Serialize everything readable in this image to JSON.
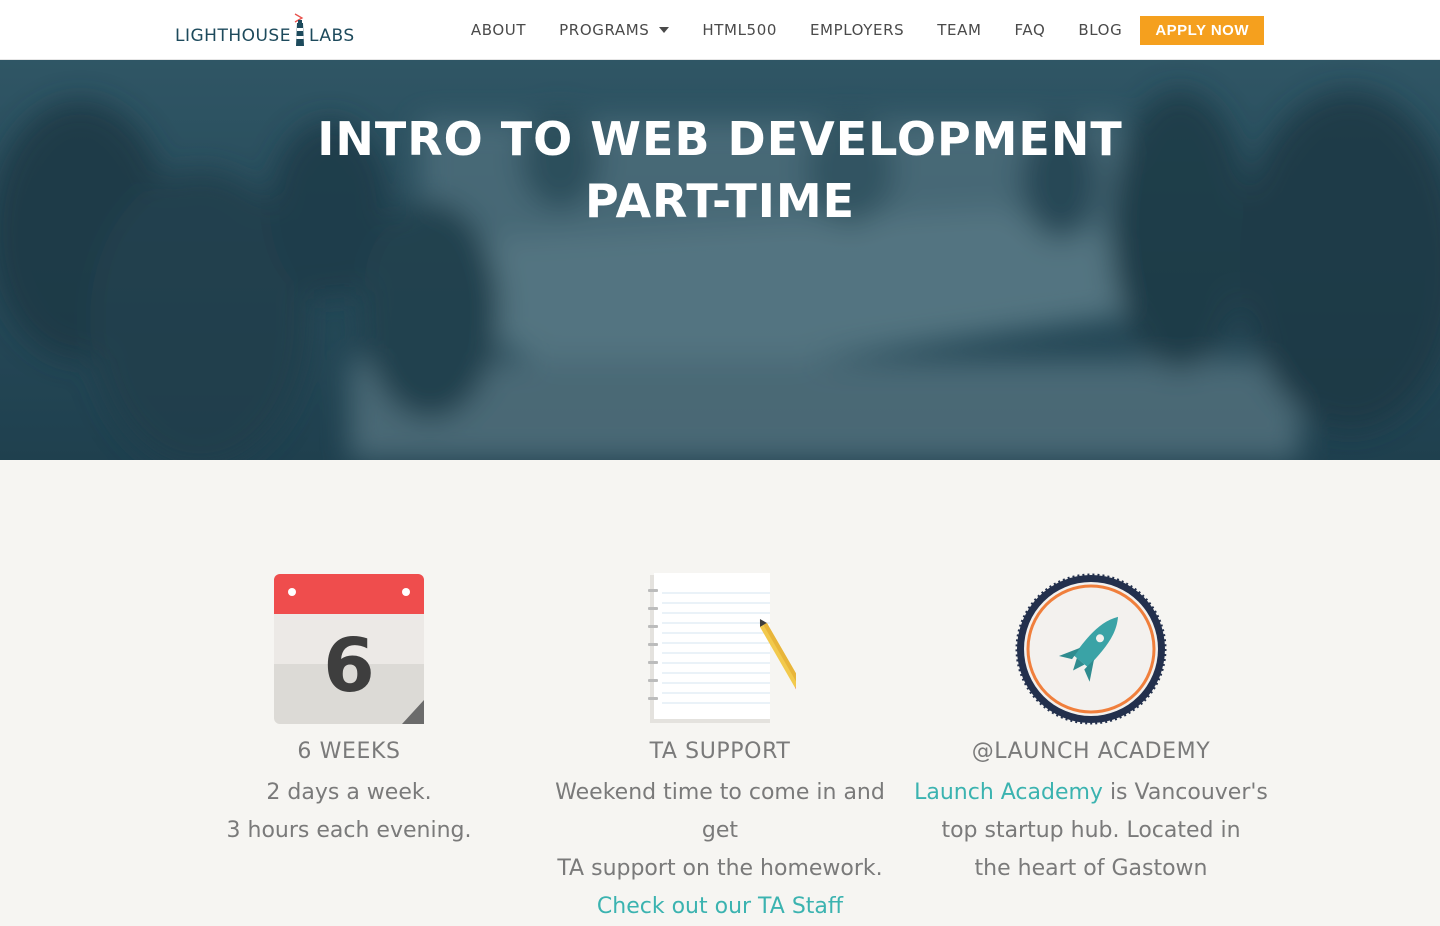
{
  "brand": {
    "left": "LIGHTHOUSE",
    "right": "LABS"
  },
  "nav": {
    "items": [
      "ABOUT",
      "PROGRAMS",
      "HTML500",
      "EMPLOYERS",
      "TEAM",
      "FAQ",
      "BLOG"
    ],
    "apply": "APPLY NOW"
  },
  "hero": {
    "line1": "INTRO TO WEB DEVELOPMENT",
    "line2": "PART-TIME"
  },
  "features": {
    "weeks": {
      "icon_number": "6",
      "title": "6 WEEKS",
      "line1": "2 days a week.",
      "line2": "3 hours each evening."
    },
    "ta": {
      "title": "TA SUPPORT",
      "line1": "Weekend time to come in and get",
      "line2": "TA support on the homework.",
      "link": "Check out our TA Staff"
    },
    "launch": {
      "title": "@LAUNCH ACADEMY",
      "link": "Launch Academy",
      "line1_rest": " is Vancouver's",
      "line2": "top startup hub. Located in",
      "line3": "the heart of Gastown"
    }
  },
  "colors": {
    "accent": "#f5a01e",
    "link": "#3bb3b0",
    "brand": "#1d4a5c"
  }
}
